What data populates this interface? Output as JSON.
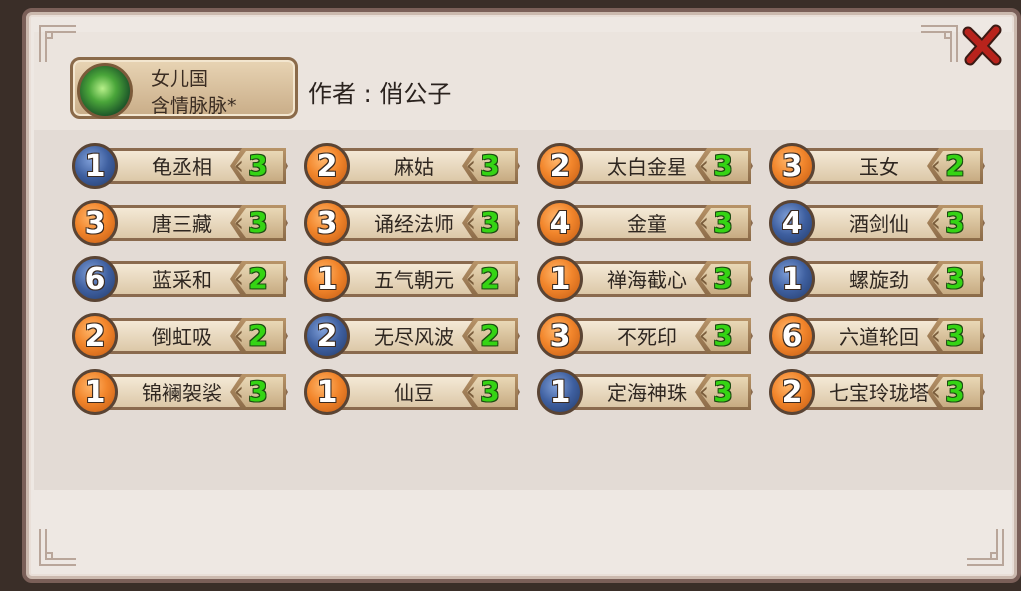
{
  "deck": {
    "faction": "女儿国",
    "name": "含情脉脉*"
  },
  "author": {
    "label": "作者：",
    "display": "作者 : 俏公子",
    "name": "俏公子"
  },
  "close_icon": "close-x-icon",
  "colors": {
    "count_green": "#35d414",
    "cost_orange": "#f2862c",
    "cost_blue": "#3e5f9f",
    "panel_bg": "#eee8e3",
    "frame_brown": "#7a5f58"
  },
  "cards": [
    {
      "cost": "1",
      "color": "blue",
      "name": "龟丞相",
      "count": "3"
    },
    {
      "cost": "2",
      "color": "orange",
      "name": "麻姑",
      "count": "3"
    },
    {
      "cost": "2",
      "color": "orange",
      "name": "太白金星",
      "count": "3"
    },
    {
      "cost": "3",
      "color": "orange",
      "name": "玉女",
      "count": "2"
    },
    {
      "cost": "3",
      "color": "orange",
      "name": "唐三藏",
      "count": "3"
    },
    {
      "cost": "3",
      "color": "orange",
      "name": "诵经法师",
      "count": "3"
    },
    {
      "cost": "4",
      "color": "orange",
      "name": "金童",
      "count": "3"
    },
    {
      "cost": "4",
      "color": "blue",
      "name": "酒剑仙",
      "count": "3"
    },
    {
      "cost": "6",
      "color": "blue",
      "name": "蓝采和",
      "count": "2"
    },
    {
      "cost": "1",
      "color": "orange",
      "name": "五气朝元",
      "count": "2"
    },
    {
      "cost": "1",
      "color": "orange",
      "name": "禅海截心",
      "count": "3"
    },
    {
      "cost": "1",
      "color": "blue",
      "name": "螺旋劲",
      "count": "3"
    },
    {
      "cost": "2",
      "color": "orange",
      "name": "倒虹吸",
      "count": "2"
    },
    {
      "cost": "2",
      "color": "blue",
      "name": "无尽风波",
      "count": "2"
    },
    {
      "cost": "3",
      "color": "orange",
      "name": "不死印",
      "count": "3"
    },
    {
      "cost": "6",
      "color": "orange",
      "name": "六道轮回",
      "count": "3"
    },
    {
      "cost": "1",
      "color": "orange",
      "name": "锦襕袈裟",
      "count": "3"
    },
    {
      "cost": "1",
      "color": "orange",
      "name": "仙豆",
      "count": "3"
    },
    {
      "cost": "1",
      "color": "blue",
      "name": "定海神珠",
      "count": "3"
    },
    {
      "cost": "2",
      "color": "orange",
      "name": "七宝玲珑塔",
      "count": "3"
    }
  ]
}
